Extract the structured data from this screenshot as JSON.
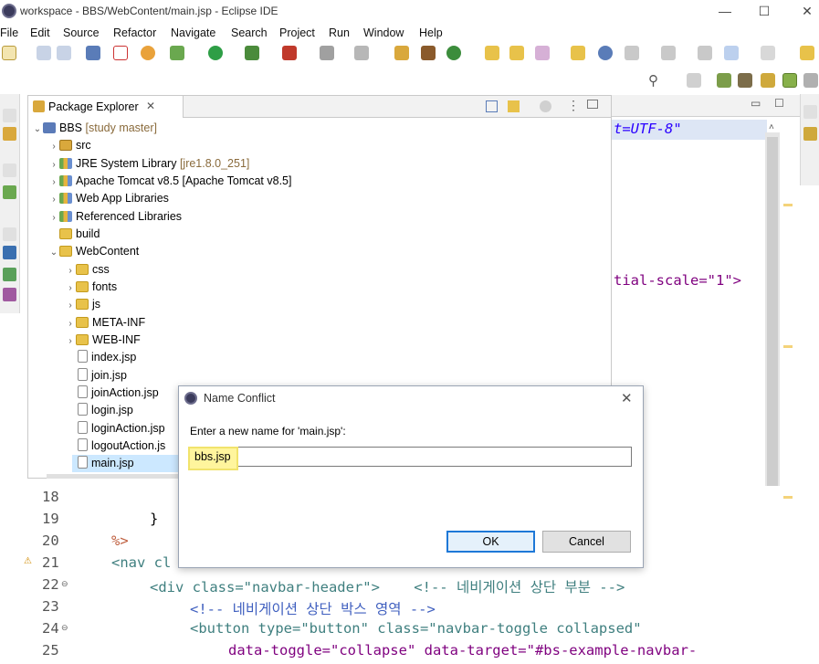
{
  "window": {
    "title": "workspace - BBS/WebContent/main.jsp - Eclipse IDE",
    "min": "—",
    "max": "☐",
    "close": "✕"
  },
  "menu": [
    "File",
    "Edit",
    "Source",
    "Refactor",
    "Navigate",
    "Search",
    "Project",
    "Run",
    "Window",
    "Help"
  ],
  "explorer": {
    "tab_label": "Package Explorer",
    "tab_close": "✕",
    "rows": [
      {
        "label": "BBS",
        "decoration": "[study master]"
      },
      {
        "label": "src",
        "decoration": ""
      },
      {
        "label": "JRE System Library",
        "decoration": "[jre1.8.0_251]"
      },
      {
        "label": "Apache Tomcat v8.5 [Apache Tomcat v8.5]",
        "decoration": ""
      },
      {
        "label": "Web App Libraries",
        "decoration": ""
      },
      {
        "label": "Referenced Libraries",
        "decoration": ""
      },
      {
        "label": "build",
        "decoration": ""
      },
      {
        "label": "WebContent",
        "decoration": ""
      },
      {
        "label": "css",
        "decoration": ""
      },
      {
        "label": "fonts",
        "decoration": ""
      },
      {
        "label": "js",
        "decoration": ""
      },
      {
        "label": "META-INF",
        "decoration": ""
      },
      {
        "label": "WEB-INF",
        "decoration": ""
      },
      {
        "label": "index.jsp",
        "decoration": ""
      },
      {
        "label": "join.jsp",
        "decoration": ""
      },
      {
        "label": "joinAction.jsp",
        "decoration": ""
      },
      {
        "label": "login.jsp",
        "decoration": ""
      },
      {
        "label": "loginAction.jsp",
        "decoration": ""
      },
      {
        "label": "logoutAction.js",
        "decoration": ""
      },
      {
        "label": "main.jsp",
        "decoration": ""
      }
    ]
  },
  "editor": {
    "top_line_1": "t=UTF-8\"",
    "top_line_2": "tial-scale=\"1\">",
    "right_fragment": ");",
    "lines": [
      {
        "num": "18",
        "text": ""
      },
      {
        "num": "19",
        "text": "}"
      },
      {
        "num": "20",
        "text": "%>"
      },
      {
        "num": "21",
        "text": "<nav cl"
      },
      {
        "num": "22",
        "text": "<div class=\"navbar-header\">    <!-- 네비게이션 상단 부분 -->"
      },
      {
        "num": "23",
        "text": "<!-- 네비게이션 상단 박스 영역 -->"
      },
      {
        "num": "24",
        "text": "<button type=\"button\" class=\"navbar-toggle collapsed\""
      },
      {
        "num": "25",
        "text": "data-toggle=\"collapse\" data-target=\"#bs-example-navbar-"
      }
    ]
  },
  "dialog": {
    "title": "Name Conflict",
    "close": "✕",
    "prompt": "Enter a new name for 'main.jsp':",
    "value": "bbs.jsp",
    "ok": "OK",
    "cancel": "Cancel",
    "highlight_color": "#fff59d"
  }
}
